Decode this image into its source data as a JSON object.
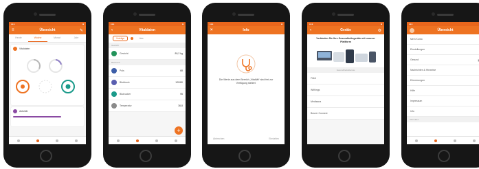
{
  "colors": {
    "brand_orange": "#ee7322",
    "teal": "#1a9a8a",
    "purple": "#8a4aa3",
    "green": "#22935a"
  },
  "phone1": {
    "title": "Übersicht",
    "tabs": [
      "Heute",
      "Woche",
      "Monat",
      "Jahr"
    ],
    "card1_title": "Vitaldaten",
    "card2_title": "Aktivität"
  },
  "phone2": {
    "title": "Vitaldaten",
    "segments": [
      "Vorträge",
      "Liste"
    ],
    "section1": "Gewicht",
    "section2": "Blutdruck",
    "rows": [
      {
        "label": "Gewicht",
        "value": "80,2 kg"
      },
      {
        "label": "Puls",
        "value": "68"
      },
      {
        "label": "Blutdruck",
        "value": "120/80"
      },
      {
        "label": "Blutzucker",
        "value": "95"
      },
      {
        "label": "Temperatur",
        "value": "36,8"
      }
    ]
  },
  "phone3": {
    "title": "Info",
    "message": "Die Werte aus dem Bereich „Vitalität“ sind frei zur Verfügung stellen!",
    "btn_left": "Abbrechen",
    "btn_right": "Einstellen"
  },
  "phone4": {
    "title": "Geräte",
    "heading": "Verbinden Sie Ihre Gesundheitsgeräte mit unserer Plattform",
    "section": "Gesundheitsdienste",
    "items": [
      "Fitbit",
      "Withings",
      "Medisana",
      "Beurer Connect"
    ]
  },
  "phone5": {
    "title": "Übersicht",
    "items": [
      "Mein Konto",
      "Einstellungen",
      "Gesund",
      "Nachrichten & Hinweise",
      "Erinnerungen",
      "Hilfe",
      "Impressum",
      "Info"
    ],
    "footer": "Abmelden"
  }
}
